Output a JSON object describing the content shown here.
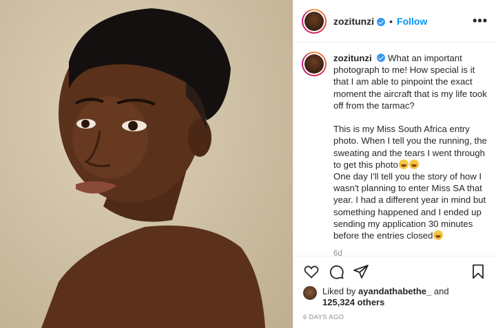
{
  "header": {
    "username": "zozitunzi",
    "separator": "•",
    "follow_label": "Follow",
    "more_label": "•••"
  },
  "caption": {
    "username": "zozitunzi",
    "text_p1": "What an important photograph to me! How special is it that I am able to pinpoint the exact moment the aircraft that is my life took off from the tarmac?",
    "text_p2": "This is my Miss South Africa entry photo. When I tell you the running, the sweating and the tears I went through to get this photo",
    "text_p3": "One day I'll tell you the story of how I wasn't planning to enter Miss SA that year. I had a different year in mind but something happened and I ended up sending my application 30 minutes before the entries closed",
    "time_ago": "6d"
  },
  "actions": {
    "like_icon": "heart-icon",
    "comment_icon": "comment-icon",
    "share_icon": "paper-plane-icon",
    "save_icon": "bookmark-icon"
  },
  "likes": {
    "prefix": "Liked by ",
    "user": "ayandathabethe_",
    "and": " and",
    "count": "125,324 others"
  },
  "posted": "6 DAYS AGO",
  "colors": {
    "link_blue": "#0095f6",
    "muted": "#8e8e8e",
    "photo_background": "#d8c9ad"
  }
}
